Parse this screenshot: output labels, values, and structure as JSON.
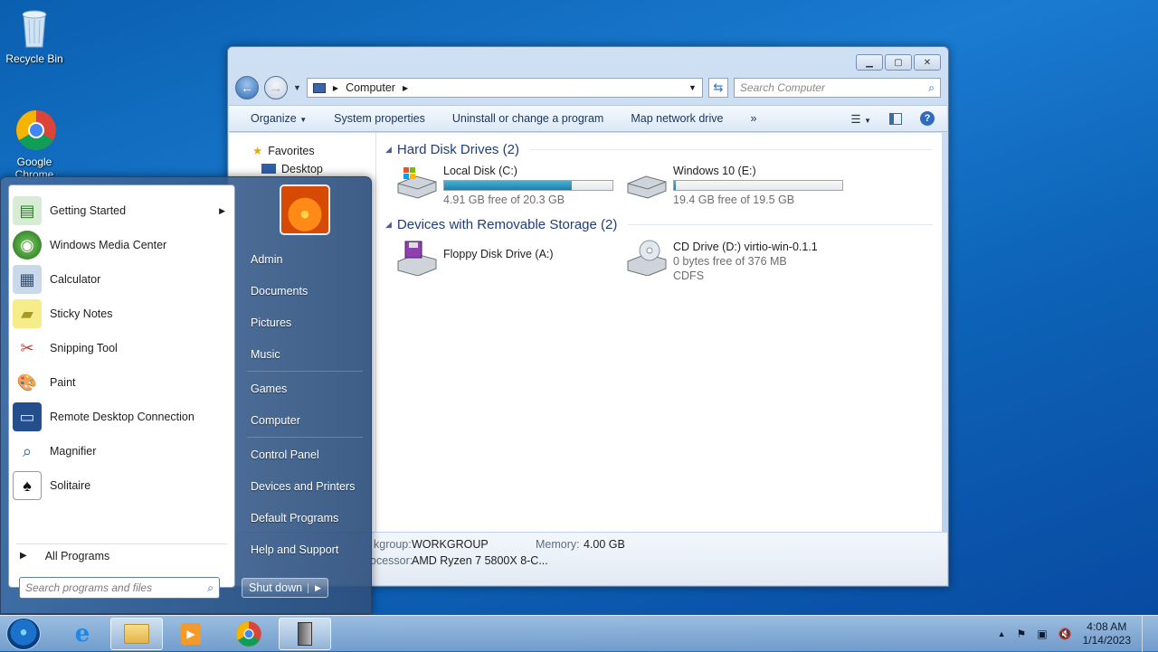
{
  "desktop": {
    "icons": [
      {
        "label": "Recycle Bin",
        "icon": "recycle-bin-icon"
      },
      {
        "label": "Google Chrome",
        "icon": "chrome-icon"
      }
    ]
  },
  "explorer": {
    "address": "Computer",
    "search_placeholder": "Search Computer",
    "commands": [
      "Organize",
      "System properties",
      "Uninstall or change a program",
      "Map network drive"
    ],
    "more": "»",
    "nav": {
      "favorites": "Favorites",
      "desktop": "Desktop"
    },
    "groups": {
      "hard_disks": "Hard Disk Drives (2)",
      "removable": "Devices with Removable Storage (2)"
    },
    "drives": [
      {
        "name": "Local Disk (C:)",
        "detail": "4.91 GB free of 20.3 GB",
        "used_fraction": 0.76
      },
      {
        "name": "Windows 10 (E:)",
        "detail": "19.4 GB free of 19.5 GB",
        "used_fraction": 0.005
      },
      {
        "name": "Floppy Disk Drive (A:)"
      },
      {
        "name": "CD Drive (D:) virtio-win-0.1.1",
        "detail": "0 bytes free of 376 MB",
        "fs": "CDFS"
      }
    ],
    "details": {
      "workgroup_label": "kgroup:",
      "workgroup": "WORKGROUP",
      "memory_label": "Memory:",
      "memory": "4.00 GB",
      "processor_label": "ocessor:",
      "processor": "AMD Ryzen 7 5800X 8-C..."
    }
  },
  "start_menu": {
    "programs": [
      {
        "label": "Getting Started",
        "submenu": "▶"
      },
      {
        "label": "Windows Media Center"
      },
      {
        "label": "Calculator"
      },
      {
        "label": "Sticky Notes"
      },
      {
        "label": "Snipping Tool"
      },
      {
        "label": "Paint"
      },
      {
        "label": "Remote Desktop Connection"
      },
      {
        "label": "Magnifier"
      },
      {
        "label": "Solitaire"
      }
    ],
    "all_programs": "All Programs",
    "search_placeholder": "Search programs and files",
    "right": [
      "Admin",
      "Documents",
      "Pictures",
      "Music",
      "Games",
      "Computer",
      "Control Panel",
      "Devices and Printers",
      "Default Programs",
      "Help and Support"
    ],
    "shutdown": "Shut down"
  },
  "taskbar": {
    "time": "4:08 AM",
    "date": "1/14/2023"
  }
}
